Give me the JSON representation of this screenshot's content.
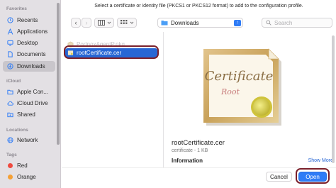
{
  "dialog": {
    "prompt": "Select a certificate or identity file (PKCS1 or PKCS12 format) to add to the configuration profile."
  },
  "sidebar": {
    "sections": {
      "favorites": "Favorites",
      "icloud": "iCloud",
      "locations": "Locations",
      "tags": "Tags"
    },
    "favorites": [
      {
        "label": "Recents",
        "icon": "clock-icon"
      },
      {
        "label": "Applications",
        "icon": "applications-icon"
      },
      {
        "label": "Desktop",
        "icon": "desktop-icon"
      },
      {
        "label": "Documents",
        "icon": "document-icon"
      },
      {
        "label": "Downloads",
        "icon": "download-icon",
        "selected": true
      }
    ],
    "icloud": [
      {
        "label": "Apple Con...",
        "icon": "folder-icon"
      },
      {
        "label": "iCloud Drive",
        "icon": "cloud-icon"
      },
      {
        "label": "Shared",
        "icon": "shared-folder-icon"
      }
    ],
    "locations": [
      {
        "label": "Network",
        "icon": "globe-icon"
      }
    ],
    "tags": [
      {
        "label": "Red",
        "color": "#ef4a3f"
      },
      {
        "label": "Orange",
        "color": "#f5a035"
      }
    ]
  },
  "toolbar": {
    "path_location": "Downloads",
    "search_placeholder": "Search"
  },
  "files": [
    {
      "name": "PortnoxAgentP.pkg",
      "icon": "package-icon",
      "enabled": false
    },
    {
      "name": "rootCertificate.cer",
      "icon": "certificate-icon",
      "selected": true
    }
  ],
  "preview": {
    "image_script": "Certificate",
    "image_subscript": "Root",
    "file_name": "rootCertificate.cer",
    "meta": "certificate - 1 KB",
    "info_heading": "Information",
    "show_more": "Show More"
  },
  "buttons": {
    "cancel": "Cancel",
    "open": "Open"
  },
  "colors": {
    "accent": "#2f7cf6",
    "selection": "#2766d4",
    "annotation_ring": "#7a1f2a"
  }
}
